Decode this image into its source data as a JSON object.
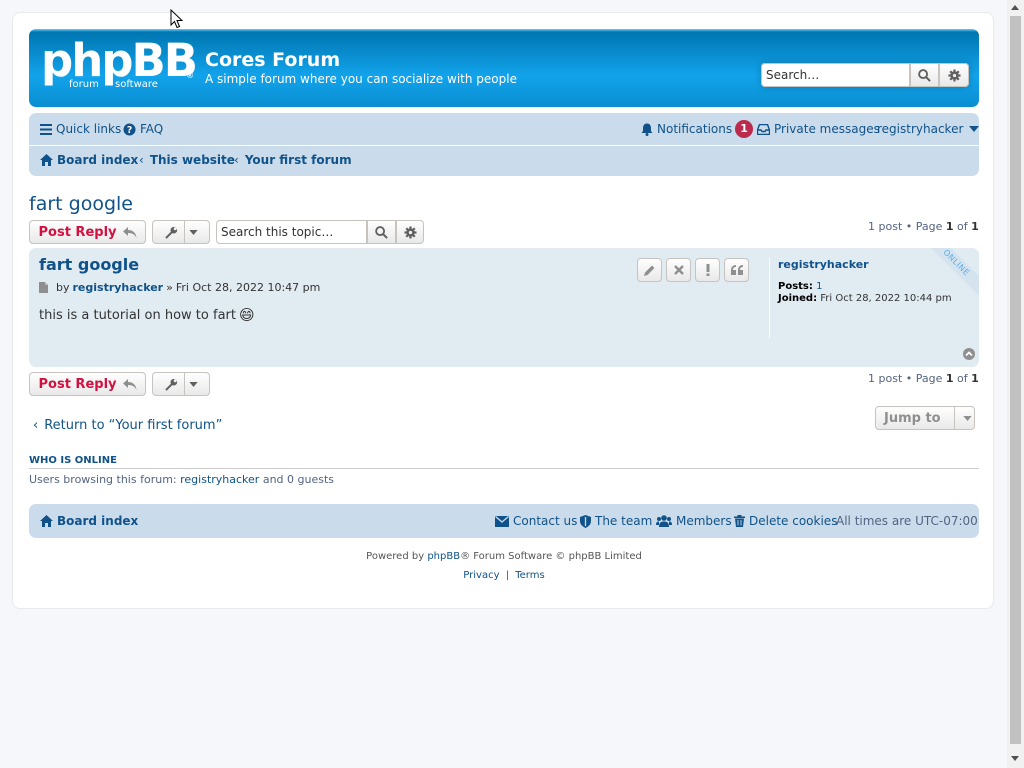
{
  "header": {
    "logo_text": "phpBB",
    "logo_sub_left": "forum",
    "logo_sub_right": "software",
    "logo_reg": "®",
    "site_title": "Cores Forum",
    "site_description": "A simple forum where you can socialize with people",
    "search_placeholder": "Search…",
    "search_icon": "search-icon",
    "advanced_search_icon": "gear-icon"
  },
  "navbar": {
    "quick_links": "Quick links",
    "faq": "FAQ",
    "notifications": "Notifications",
    "notification_count": "1",
    "private_messages": "Private messages",
    "username": "registryhacker",
    "breadcrumbs": [
      "Board index",
      "This website",
      "Your first forum"
    ]
  },
  "topic": {
    "title": "fart google",
    "post_reply": "Post Reply",
    "search_topic_placeholder": "Search this topic…",
    "pagination_top": {
      "count": "1 post",
      "page_label": "Page",
      "current": "1",
      "of": "of",
      "total": "1"
    },
    "pagination_bottom": {
      "count": "1 post",
      "page_label": "Page",
      "current": "1",
      "of": "of",
      "total": "1"
    }
  },
  "post": {
    "title": "fart google",
    "by": "by",
    "author": "registryhacker",
    "separator": "»",
    "date": "Fri Oct 28, 2022 10:47 pm",
    "content": "this is a tutorial on how to fart",
    "emoji": "😄",
    "profile": {
      "username": "registryhacker",
      "posts_label": "Posts:",
      "posts_value": "1",
      "joined_label": "Joined:",
      "joined_value": "Fri Oct 28, 2022 10:44 pm",
      "online": "ONLINE"
    }
  },
  "actions": {
    "return_text": "Return to “Your first forum”",
    "jump_to": "Jump to"
  },
  "who_is_online": {
    "heading": "WHO IS ONLINE",
    "text_prefix": "Users browsing this forum:",
    "user": "registryhacker",
    "text_suffix": "and 0 guests"
  },
  "footer_nav": {
    "board_index": "Board index",
    "contact_us": "Contact us",
    "the_team": "The team",
    "members": "Members",
    "delete_cookies": "Delete cookies",
    "timezone": "All times are UTC-07:00"
  },
  "copyright": {
    "powered_by": "Powered by",
    "phpbb": "phpBB",
    "rest": "® Forum Software © phpBB Limited",
    "privacy": "Privacy",
    "sep": "|",
    "terms": "Terms"
  },
  "colors": {
    "header_blue": "#12a3eb",
    "nav_bg": "#cadceb",
    "post_bg": "#e1ebf2",
    "link": "#105289",
    "post_reply": "#d31141",
    "badge": "#bc2a4d"
  }
}
